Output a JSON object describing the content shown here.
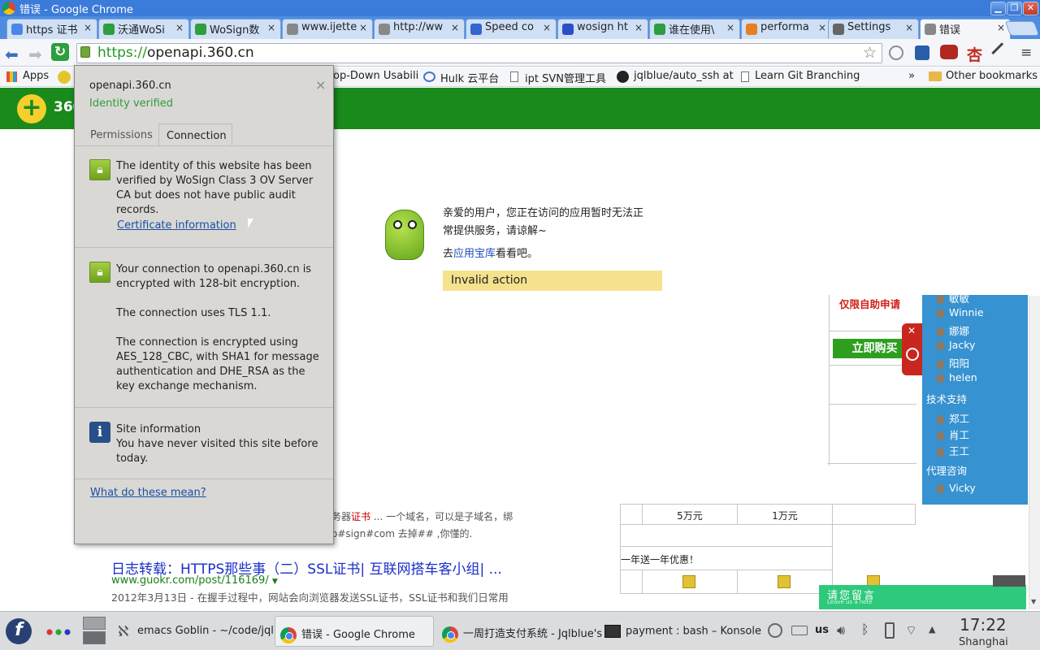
{
  "window": {
    "title": "错误 - Google Chrome"
  },
  "tabs": [
    {
      "label": "https 证书",
      "icon": "google-icon",
      "color": "#4a86e8"
    },
    {
      "label": "沃通WoSi",
      "icon": "check-icon",
      "color": "#2e9e3e"
    },
    {
      "label": "WoSign数",
      "icon": "check-icon",
      "color": "#2e9e3e"
    },
    {
      "label": "www.ijette",
      "icon": "page-icon",
      "color": "#888888"
    },
    {
      "label": "http://ww",
      "icon": "page-icon",
      "color": "#888888"
    },
    {
      "label": "Speed co",
      "icon": "speed-icon",
      "color": "#3366cc"
    },
    {
      "label": "wosign ht",
      "icon": "paw-icon",
      "color": "#2c4fc4"
    },
    {
      "label": "谁在使用\\",
      "icon": "check-icon",
      "color": "#2e9e3e"
    },
    {
      "label": "performa",
      "icon": "stack-icon",
      "color": "#e67e22"
    },
    {
      "label": "Settings",
      "icon": "gear-icon",
      "color": "#666666"
    },
    {
      "label": "错误",
      "icon": "page-icon",
      "color": "#888888"
    }
  ],
  "url": {
    "scheme": "https://",
    "host": "openapi.360.cn"
  },
  "bookmarks": [
    {
      "label": "Apps"
    },
    {
      "label": "op-Down Usabili"
    },
    {
      "label": "Hulk 云平台"
    },
    {
      "label": "ipt SVN管理工具"
    },
    {
      "label": "jqlblue/auto_ssh at"
    },
    {
      "label": "Learn Git Branching"
    },
    {
      "label": "»"
    },
    {
      "label": "Other bookmarks"
    }
  ],
  "popup": {
    "host": "openapi.360.cn",
    "status": "Identity verified",
    "tab_permissions": "Permissions",
    "tab_connection": "Connection",
    "identity_text": "The identity of this website has been verified by WoSign Class 3 OV Server CA but does not have public audit records.",
    "cert_link": "Certificate information",
    "conn_text1": "Your connection to openapi.360.cn is encrypted with 128-bit encryption.",
    "conn_text2": "The connection uses TLS 1.1.",
    "conn_text3": "The connection is encrypted using AES_128_CBC, with SHA1 for message authentication and DHE_RSA as the key exchange mechanism.",
    "site_info_title": "Site information",
    "site_info_text": "You have never visited this site before today.",
    "help_link": "What do these mean?",
    "close": "×"
  },
  "page": {
    "brand": "360",
    "msg1": "亲爱的用户，您正在访问的应用暂时无法正",
    "msg2": "常提供服务，请谅解~",
    "msg3_pre": "去",
    "msg3_link": "应用宝库",
    "msg3_post": "看看吧。",
    "error": "Invalid action",
    "apply": "仅限自助申请",
    "buy": "立即购买",
    "table_5w": "5万元",
    "table_1w": "1万元",
    "promo": "一年送一年优惠！",
    "snippet1a": "务器",
    "snippet1b": "证书",
    "snippet1c": " ... 一个域名，可以是子域名，绑",
    "snippet2": "o#sign#com 去掉## ,你懂的.",
    "result_title": "日志转载：HTTPS那些事（二）SSL证书| 互联网搭车客小组| ...",
    "result_url": "www.guokr.com/post/116169/",
    "result_desc_date": "2012年3月13日",
    "result_desc": " - 在握手过程中，网站会向浏览器发送SSL证书，SSL证书和我们日常用",
    "feedback": "请您留言",
    "feedback_sub": "Leave us a note"
  },
  "support": {
    "partial_top": "敏敏",
    "sales": [
      "Winnie",
      "娜娜",
      "Jacky",
      "阳阳",
      "helen"
    ],
    "tech_title": "技术支持",
    "tech": [
      "郑工",
      "肖工",
      "王工"
    ],
    "agent_title": "代理咨询",
    "agent": [
      "Vicky"
    ]
  },
  "taskbar": {
    "tasks": [
      {
        "label": "emacs Goblin - ~/code/jql"
      },
      {
        "label": "错误 - Google Chrome"
      },
      {
        "label": "一周打造支付系统 - Jqlblue's"
      },
      {
        "label": "payment : bash – Konsole"
      }
    ],
    "keyboard": "us",
    "time": "17:22",
    "location": "Shanghai"
  }
}
